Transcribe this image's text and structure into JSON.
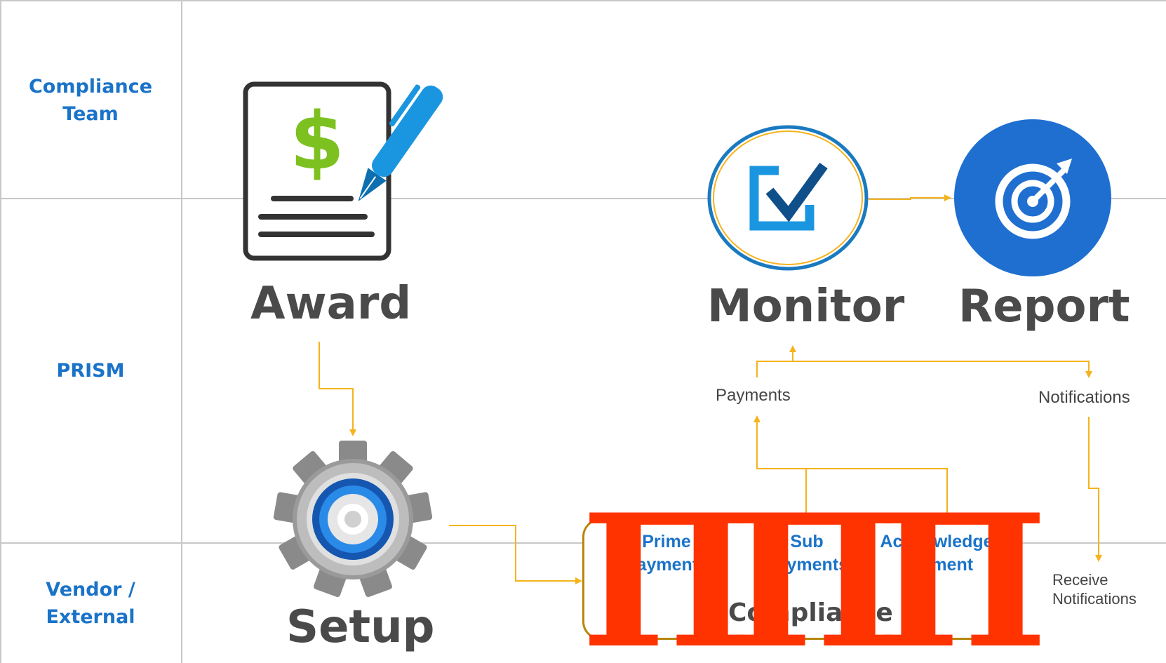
{
  "lanes": {
    "compliance_team": "Compliance\nTeam",
    "prism": "PRISM",
    "vendor_external": "Vendor /\nExternal"
  },
  "steps": {
    "award": "Award",
    "setup": "Setup",
    "monitor": "Monitor",
    "report": "Report"
  },
  "flow_labels": {
    "payments": "Payments",
    "notifications": "Notifications",
    "receive_notifications": "Receive\nNotifications"
  },
  "compliance_box": {
    "title": "Compliance",
    "items": [
      "Prime\nPayments",
      "Sub\nPayments",
      "Acknowledge\nPayment"
    ]
  },
  "overlay_glyphs": [
    "П",
    "П",
    "П"
  ],
  "colors": {
    "lane_label": "#1a73c8",
    "arrow": "#f5b31c",
    "overlay": "#ff3300",
    "box_border": "#b8860b",
    "report_circle": "#1f6fd1",
    "dollar": "#7cc11f",
    "pen": "#1a96e0"
  },
  "icons": {
    "award": "contract-signing-icon",
    "setup": "gear-icon",
    "monitor": "checkbox-icon",
    "report": "target-icon"
  }
}
